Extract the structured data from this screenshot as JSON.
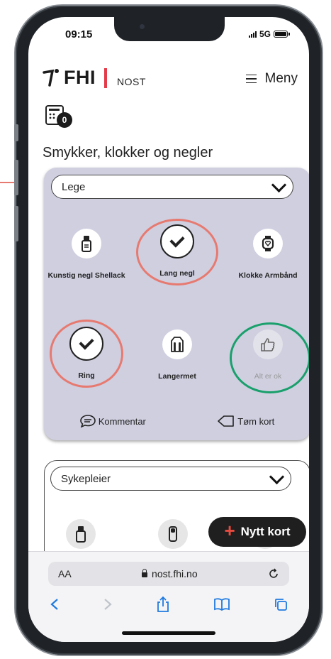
{
  "status": {
    "time": "09:15",
    "network": "5G"
  },
  "header": {
    "logo": "FHI",
    "subtitle": "NOST",
    "menu_label": "Meny"
  },
  "counter": {
    "value": "0"
  },
  "page": {
    "title": "Smykker, klokker og negler"
  },
  "card1": {
    "role": "Lege",
    "items": [
      {
        "label": "Kunstig negl Shellack",
        "icon": "nail-bottle-icon",
        "selected": false
      },
      {
        "label": "Lang negl",
        "icon": "check-icon",
        "selected": true
      },
      {
        "label": "Klokke Armbånd",
        "icon": "watch-icon",
        "selected": false
      },
      {
        "label": "Ring",
        "icon": "check-icon",
        "selected": true
      },
      {
        "label": "Langermet",
        "icon": "long-sleeve-icon",
        "selected": false
      },
      {
        "label": "Alt er ok",
        "icon": "thumbs-up-icon",
        "selected": false
      }
    ],
    "comment_label": "Kommentar",
    "clear_label": "Tøm kort"
  },
  "card2": {
    "role": "Sykepleier"
  },
  "fab": {
    "label": "Nytt kort"
  },
  "browser": {
    "aa": "AA",
    "url": "nost.fhi.no"
  },
  "colors": {
    "card_bg": "#cfcfe0",
    "accent_red": "#e33b49",
    "annotation_red": "#e77a70",
    "annotation_green": "#1aa06c",
    "link_blue": "#1f7ae0"
  }
}
